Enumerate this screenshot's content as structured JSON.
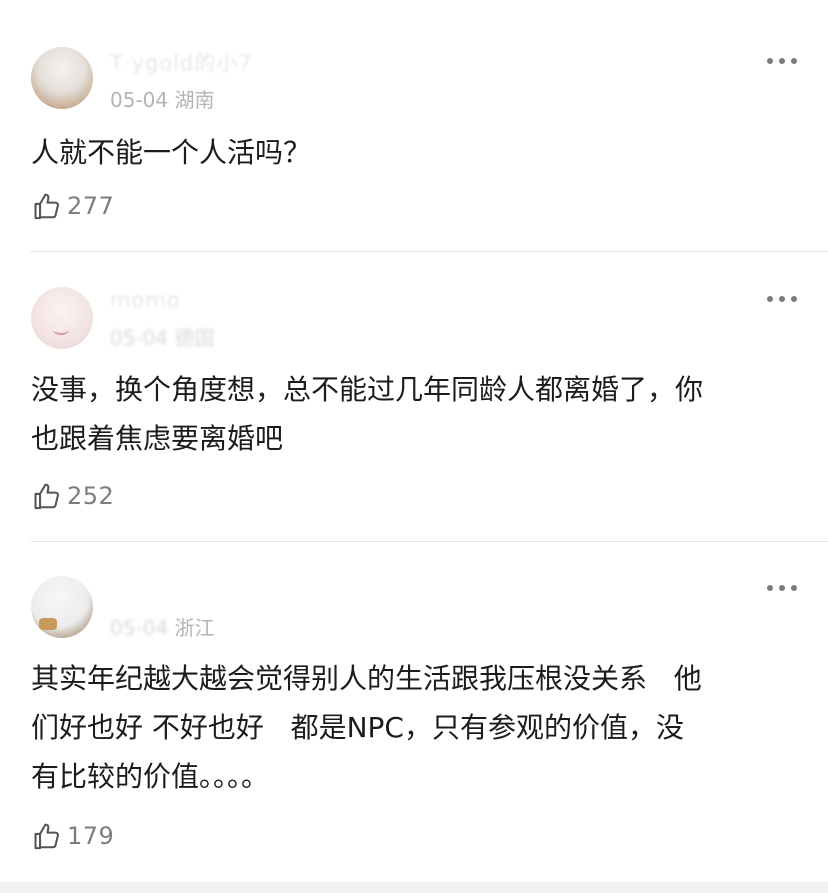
{
  "comments": [
    {
      "username": "T·ygold的小7",
      "date": "05-04",
      "location": "湖南",
      "text": "人就不能一个人活吗？",
      "likes": "277"
    },
    {
      "username": "momo",
      "date": "05-04",
      "location": "德国",
      "text": "没事，换个角度想，总不能过几年同龄人都离婚了，你\n也跟着焦虑要离婚吧",
      "likes": "252"
    },
    {
      "username": "",
      "date": "05-04",
      "location": "浙江",
      "text": "其实年纪越大越会觉得别人的生活跟我压根没关系   他\n们好也好 不好也好   都是NPC，只有参观的价值，没\n有比较的价值。。。。",
      "likes": "179"
    }
  ],
  "icons": {
    "more": "more-dots-icon",
    "like": "thumbs-up-icon"
  },
  "colors": {
    "text": "#1c1c1c",
    "meta": "#b4b4b4",
    "count": "#7d7d7d",
    "divider": "#e8e8e8"
  }
}
